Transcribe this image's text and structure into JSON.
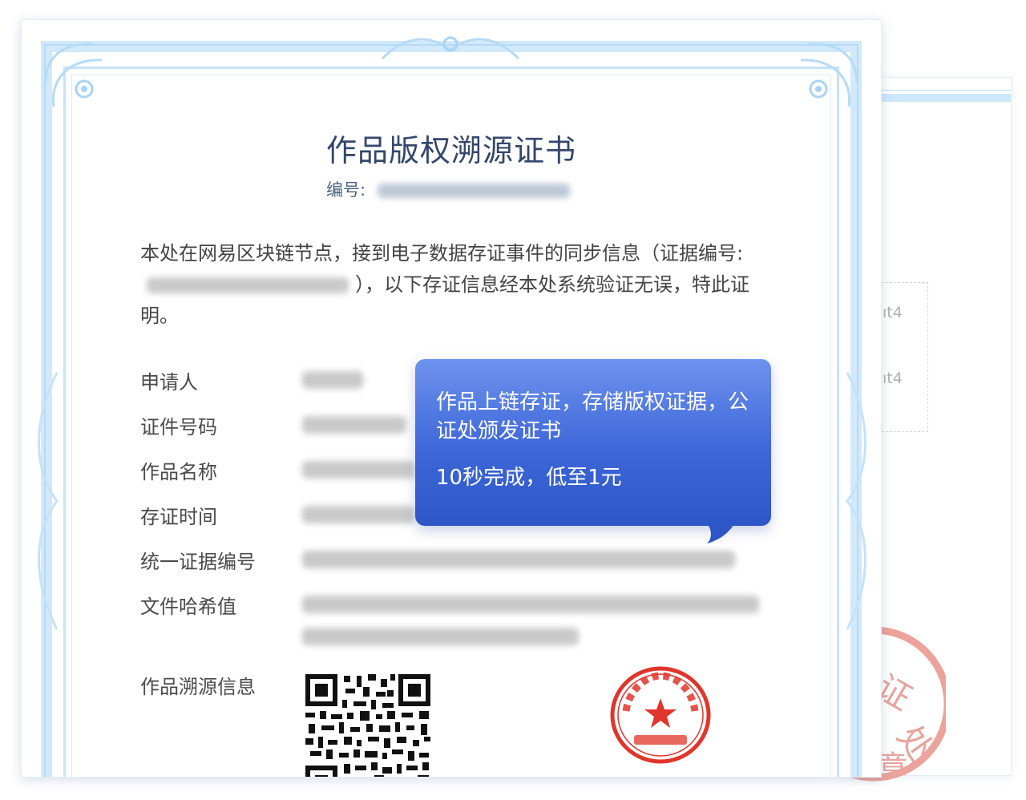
{
  "certificate": {
    "title": "作品版权溯源证书",
    "serial_label": "编号:",
    "intro_part1": "本处在网易区块链节点，接到电子数据存证事件的同步信息（证据编号:",
    "intro_part2": "），以下存证信息经本处系统验证无误，特此证明。",
    "rows": [
      {
        "label": "申请人"
      },
      {
        "label": "证件号码"
      },
      {
        "label": "作品名称"
      },
      {
        "label": "存证时间"
      },
      {
        "label": "统一证据编号"
      },
      {
        "label": "文件哈希值"
      },
      {
        "label": "作品溯源信息"
      }
    ]
  },
  "tooltip": {
    "line1": "作品上链存证，存储版权证据，公证处颁发证书",
    "line2": "10秒完成，低至1元"
  },
  "back_certificate": {
    "value_1": "ıt4",
    "value_2": "ıt4"
  },
  "colors": {
    "frame": "#d2e9fc",
    "title": "#34476b",
    "tooltip_top": "#6e92ef",
    "tooltip_bottom": "#2d56c6",
    "seal": "#e0352b"
  }
}
